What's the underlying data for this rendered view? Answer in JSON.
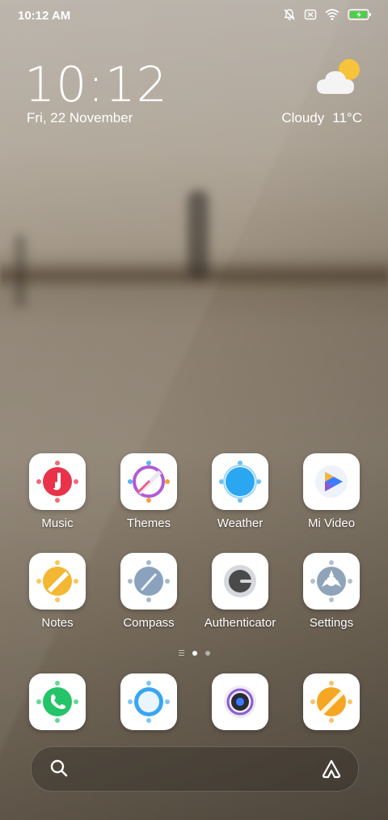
{
  "status_bar": {
    "time": "10:12 AM",
    "icons": [
      "muted-bell-icon",
      "no-sim-icon",
      "wifi-icon",
      "battery-charging-icon"
    ]
  },
  "clock": {
    "time": "10:12",
    "date": "Fri, 22 November"
  },
  "weather": {
    "condition": "Cloudy",
    "temperature": "11°C",
    "icon": "partly-cloudy-icon"
  },
  "apps": [
    {
      "label": "Music",
      "accent": "#e8334a",
      "icon": "music-icon"
    },
    {
      "label": "Themes",
      "accent": "#8b4fd6",
      "icon": "themes-icon"
    },
    {
      "label": "Weather",
      "accent": "#2aa7f0",
      "icon": "weather-app-icon"
    },
    {
      "label": "Mi Video",
      "accent": "#3b7cff",
      "icon": "video-play-icon"
    },
    {
      "label": "Notes",
      "accent": "#f4b733",
      "icon": "notes-icon"
    },
    {
      "label": "Compass",
      "accent": "#8aa2bd",
      "icon": "compass-icon"
    },
    {
      "label": "Authenticator",
      "accent": "#5a5a5a",
      "icon": "authenticator-icon"
    },
    {
      "label": "Settings",
      "accent": "#8fa4b8",
      "icon": "settings-gear-icon"
    }
  ],
  "dock": [
    {
      "accent": "#24c468",
      "icon": "phone-icon"
    },
    {
      "accent": "#3aa5f2",
      "icon": "messages-icon"
    },
    {
      "accent": "#8a5ad6",
      "icon": "camera-icon"
    },
    {
      "accent": "#f5a623",
      "icon": "gallery-icon"
    }
  ],
  "pager": {
    "pages": 2,
    "current": 1
  },
  "search": {
    "icon": "search-icon",
    "assistant_icon": "assistant-icon"
  }
}
